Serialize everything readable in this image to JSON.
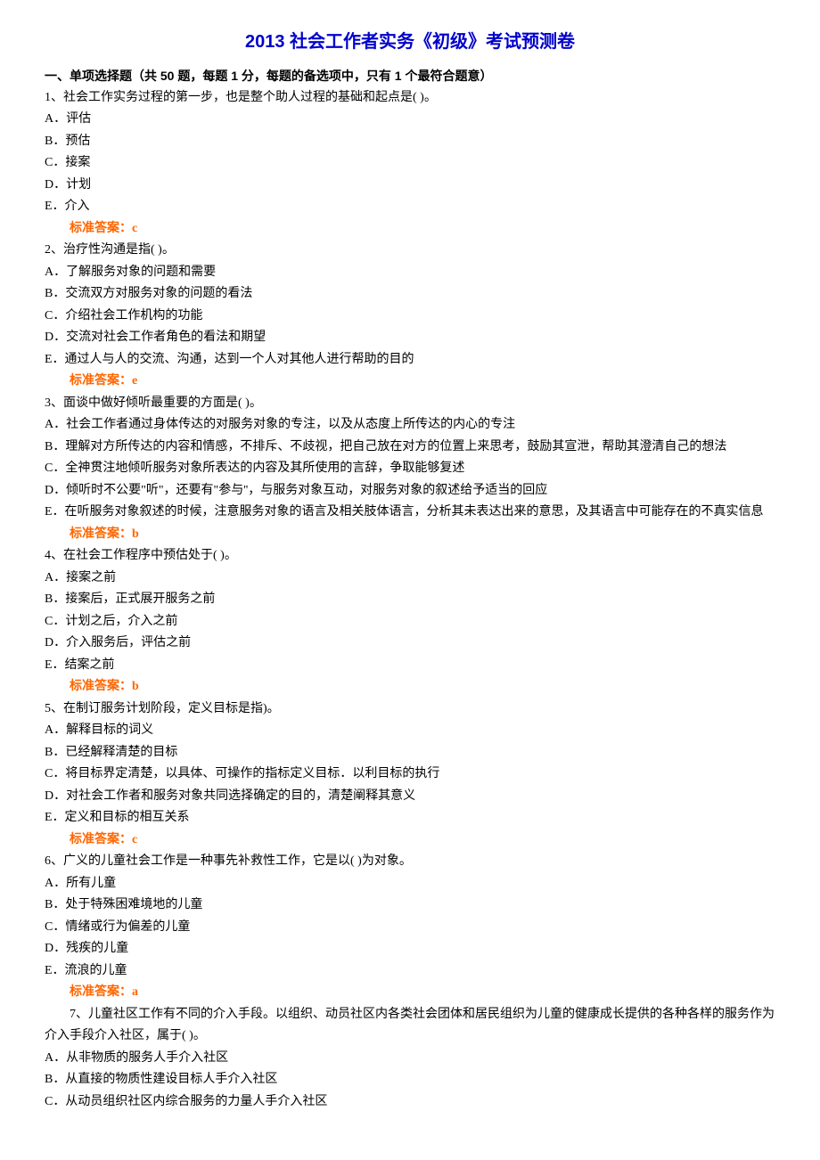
{
  "title": "2013 社会工作者实务《初级》考试预测卷",
  "section_header": "一、单项选择题（共 50 题，每题 1 分，每题的备选项中，只有 1 个最符合题意）",
  "answer_label_prefix": "标准答案：",
  "questions": [
    {
      "stem": "1、社会工作实务过程的第一步，也是整个助人过程的基础和起点是( )。",
      "options": [
        "A．评估",
        "B．预估",
        "C．接案",
        "D．计划",
        "E．介入"
      ],
      "answer": "c"
    },
    {
      "stem": "2、治疗性沟通是指( )。",
      "options": [
        "A．了解服务对象的问题和需要",
        "B．交流双方对服务对象的问题的看法",
        "C．介绍社会工作机构的功能",
        "D．交流对社会工作者角色的看法和期望",
        "E．通过人与人的交流、沟通，达到一个人对其他人进行帮助的目的"
      ],
      "answer": "e"
    },
    {
      "stem": "3、面谈中做好倾听最重要的方面是( )。",
      "options": [
        "A．社会工作者通过身体传达的对服务对象的专注，以及从态度上所传达的内心的专注",
        "B．理解对方所传达的内容和情感，不排斥、不歧视，把自己放在对方的位置上来思考，鼓励其宣泄，帮助其澄清自己的想法",
        "C．全神贯注地倾听服务对象所表达的内容及其所使用的言辞，争取能够复述",
        "D．倾听时不公要\"听\"，还要有\"参与''，与服务对象互动，对服务对象的叙述给予适当的回应",
        "E．在听服务对象叙述的时候，注意服务对象的语言及相关肢体语言，分析其未表达出来的意思，及其语言中可能存在的不真实信息"
      ],
      "answer": "b"
    },
    {
      "stem": "4、在社会工作程序中预估处于( )。",
      "options": [
        "A．接案之前",
        "B．接案后，正式展开服务之前",
        "C．计划之后，介入之前",
        "D．介入服务后，评估之前",
        "E．结案之前"
      ],
      "answer": "b"
    },
    {
      "stem": "5、在制订服务计划阶段，定义目标是指)。",
      "options": [
        "A．解释目标的词义",
        "B．已经解释清楚的目标",
        "C．将目标界定清楚，以具体、可操作的指标定义目标．以利目标的执行",
        "D．对社会工作者和服务对象共同选择确定的目的，清楚阐释其意义",
        "E．定义和目标的相互关系"
      ],
      "answer": "c"
    },
    {
      "stem": "6、广义的儿童社会工作是一种事先补救性工作，它是以( )为对象。",
      "options": [
        "A．所有儿童",
        "B．处于特殊困难境地的儿童",
        "C．情绪或行为偏差的儿童",
        "D．残疾的儿童",
        "E．流浪的儿童"
      ],
      "answer": "a"
    },
    {
      "stem": "7、儿童社区工作有不同的介入手段。以组织、动员社区内各类社会团体和居民组织为儿童的健康成长提供的各种各样的服务作为介入手段介入社区，属于( )。",
      "stem_indent": true,
      "options": [
        "A．从非物质的服务人手介入社区",
        "B．从直接的物质性建设目标人手介入社区",
        "C．从动员组织社区内综合服务的力量人手介入社区"
      ]
    }
  ]
}
